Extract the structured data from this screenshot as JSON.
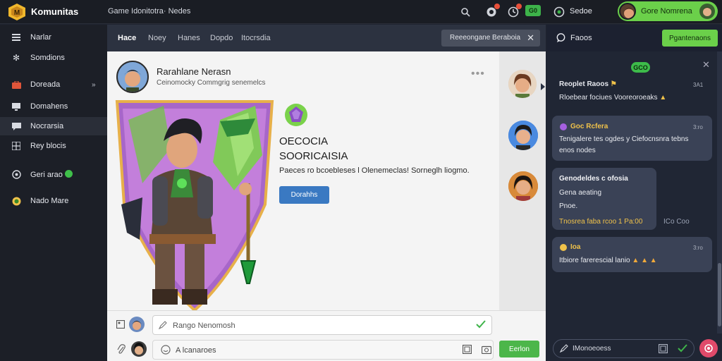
{
  "app": {
    "brand": "Komunitas"
  },
  "topbar": {
    "nav_text": "Game  Idonitotra·  Nedes",
    "green_badge": "G0",
    "status_label": "Sedoe",
    "user_name": "Gore Nomrena"
  },
  "sidebar": {
    "items": [
      {
        "label": "Narlar",
        "icon": "menu-icon"
      },
      {
        "label": "Somdions",
        "icon": "gear-icon"
      },
      {
        "label": "Doreada",
        "icon": "briefcase-icon",
        "arrow": "»"
      },
      {
        "label": "Domahens",
        "icon": "monitor-icon"
      },
      {
        "label": "Nocrarsia",
        "icon": "chat-icon"
      },
      {
        "label": "Rey blocis",
        "icon": "grid-icon"
      },
      {
        "label": "Geri arao",
        "icon": "controller-icon"
      },
      {
        "label": "Nado Mare",
        "icon": "coin-icon"
      }
    ]
  },
  "main": {
    "tabs": [
      "Hace",
      "Noey",
      "Hanes",
      "Dopdo",
      "Itocrsdia"
    ],
    "chip_label": "Reeeongane Beraboia",
    "post": {
      "author": "Rarahlane Nerasn",
      "subtitle": "Ceinomocky Commgrig senemelcs",
      "card_title_1": "OECOCIA",
      "card_title_2": "SOORICAISIA",
      "card_desc": "Paeces ro bcoebleses l Olenemeclas! Sorneglh liogmo.",
      "card_button": "Dorahhs"
    },
    "compose": {
      "input1_placeholder": "Rango Nenomosh",
      "input2_placeholder": "A lcanaroes",
      "send_button": "Eerlon"
    }
  },
  "chat": {
    "title": "Faoos",
    "top_button": "Pgantenaons",
    "pill": "GCO",
    "messages": [
      {
        "name": "Reoplet Raoos",
        "time": "3A1",
        "text": "Rloebear fociues Vooreoroeaks"
      },
      {
        "name": "Goc Rcfera",
        "time": "3:ro",
        "text": "Tenigalere tes ogdes y Ciefocnsnra tebns",
        "text2": "enos nodes"
      },
      {
        "name": "Genodeldes c ofosia",
        "time": "",
        "text": "Gena aeating",
        "text2": "Pnoe.",
        "text3": "Tnosrea faba rcoo  1 Pa:00",
        "aside": "ICo Coo"
      },
      {
        "name": "Ioa",
        "time": "3:ro",
        "text": "Itbiore farerescial lanio"
      }
    ],
    "input_placeholder": "IMonoeoess"
  }
}
